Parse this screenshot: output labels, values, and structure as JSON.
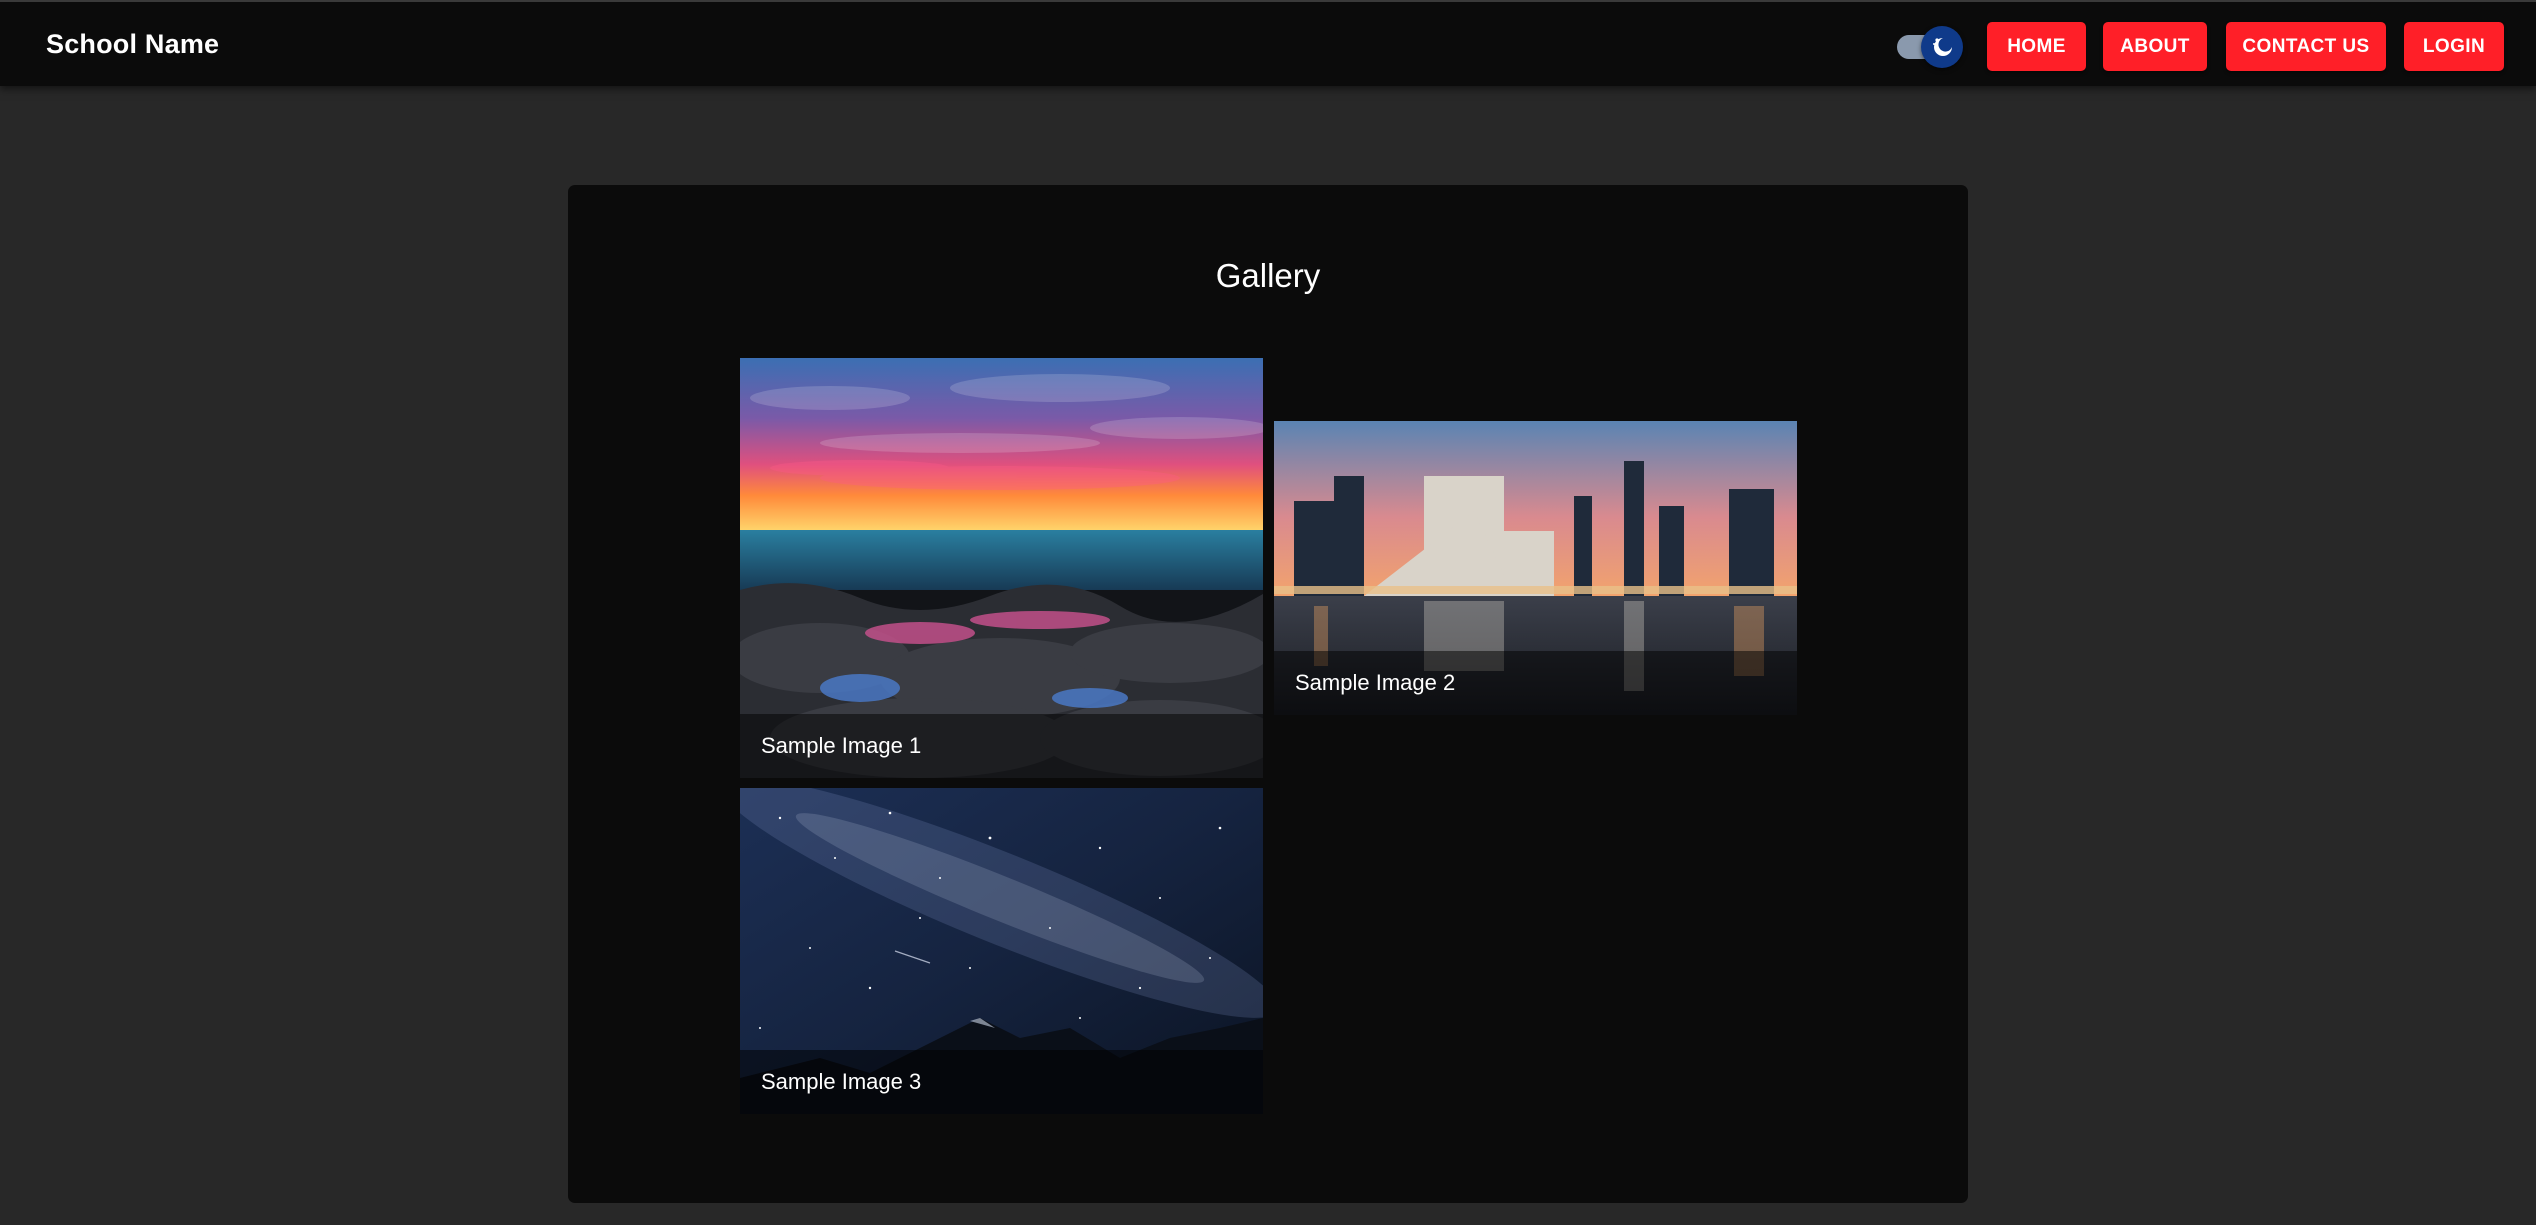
{
  "header": {
    "brand": "School Name",
    "theme_toggle": {
      "state": "dark",
      "icon": "moon-icon"
    },
    "nav": [
      {
        "label": "HOME"
      },
      {
        "label": "ABOUT"
      },
      {
        "label": "CONTACT US"
      },
      {
        "label": "LOGIN"
      }
    ]
  },
  "main": {
    "title": "Gallery",
    "images": [
      {
        "caption": "Sample Image 1",
        "subject": "sunset over rocky coastline"
      },
      {
        "caption": "Sample Image 2",
        "subject": "city skyline reflected in water at dusk"
      },
      {
        "caption": "Sample Image 3",
        "subject": "milky way starry night over mountains"
      }
    ]
  },
  "colors": {
    "page_bg": "#282828",
    "appbar_bg": "#0b0b0b",
    "card_bg": "#0b0b0b",
    "accent": "#ff1f28",
    "toggle_thumb": "#0f3a8a",
    "toggle_track": "#8a99ad"
  }
}
